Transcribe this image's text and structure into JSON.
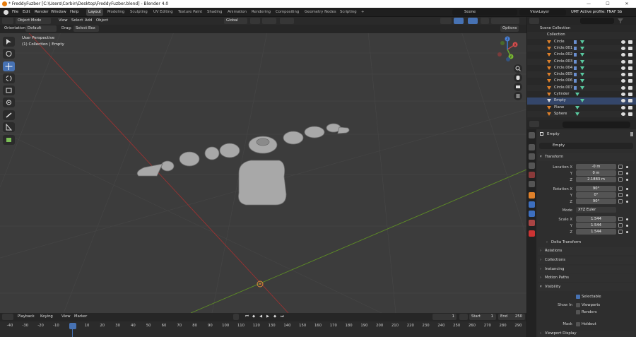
{
  "window": {
    "title": "* FreddyFuzber [C:\\Users\\Corbin\\Desktop\\FreddyFuzber.blend] - Blender 4.0",
    "min": "—",
    "max": "☐",
    "close": "✕"
  },
  "menus": [
    "File",
    "Edit",
    "Render",
    "Window",
    "Help"
  ],
  "workspaces": [
    "Layout",
    "Modeling",
    "Sculpting",
    "UV Editing",
    "Texture Paint",
    "Shading",
    "Animation",
    "Rendering",
    "Compositing",
    "Geometry Nodes",
    "Scripting",
    "+"
  ],
  "scene": {
    "label": "Scene",
    "viewlayer": "ViewLayer",
    "profile": "UMT Active profile: FNAF Sb"
  },
  "viewport_header": {
    "mode": "Object Mode",
    "menus": [
      "View",
      "Select",
      "Add",
      "Object"
    ],
    "transform": "Global",
    "options": "Options"
  },
  "viewport_header2": {
    "orientation_label": "Orientation:",
    "orientation": "Default",
    "drag_label": "Drag:",
    "drag": "Select Box"
  },
  "viewport": {
    "line1": "User Perspective",
    "line2": "(1) Collection | Empty"
  },
  "gizmo": {
    "x": "X",
    "y": "Y",
    "z": "Z"
  },
  "timeline": {
    "menus": [
      "Playback",
      "Keying",
      "View",
      "Marker"
    ],
    "current_frame": "1",
    "start_label": "Start",
    "start": "1",
    "end_label": "End",
    "end": "250",
    "ticks": [
      "-40",
      "-30",
      "-20",
      "-10",
      "1",
      "10",
      "20",
      "30",
      "40",
      "50",
      "60",
      "70",
      "80",
      "90",
      "100",
      "110",
      "120",
      "130",
      "140",
      "150",
      "160",
      "170",
      "180",
      "190",
      "200",
      "210",
      "220",
      "230",
      "240",
      "250",
      "260",
      "270",
      "280",
      "290"
    ]
  },
  "outliner": {
    "root": "Scene Collection",
    "collection": "Collection",
    "items": [
      "Circle",
      "Circle.001",
      "Circle.002",
      "Circle.003",
      "Circle.004",
      "Circle.005",
      "Circle.006",
      "Circle.007",
      "Cylinder",
      "Empty",
      "Plane",
      "Sphere"
    ],
    "selected": "Empty"
  },
  "properties": {
    "object_name": "Empty",
    "data_name": "Empty",
    "transform": {
      "header": "Transform",
      "location_label": "Location X",
      "loc_x": "-0 m",
      "loc_y": "0 m",
      "loc_z": "2.1883 m",
      "rotation_label": "Rotation X",
      "rot_x": "90°",
      "rot_y": "0°",
      "rot_z": "90°",
      "mode_label": "Mode",
      "mode": "XYZ Euler",
      "scale_label": "Scale X",
      "scale_x": "1.544",
      "scale_y": "1.544",
      "scale_z": "1.544",
      "y": "Y",
      "z": "Z"
    },
    "delta": "Delta Transform",
    "panels": [
      "Relations",
      "Collections",
      "Instancing",
      "Motion Paths"
    ],
    "visibility": {
      "header": "Visibility",
      "selectable": "Selectable",
      "show_in": "Show In",
      "viewports": "Viewports",
      "renders": "Renders",
      "mask": "Mask",
      "holdout": "Holdout"
    },
    "viewport_display": "Viewport Display"
  },
  "colors": {
    "accent": "#4772b3",
    "xaxis": "#b43b3b",
    "yaxis": "#6b9c2e",
    "mesh": "#a9a9a9"
  }
}
